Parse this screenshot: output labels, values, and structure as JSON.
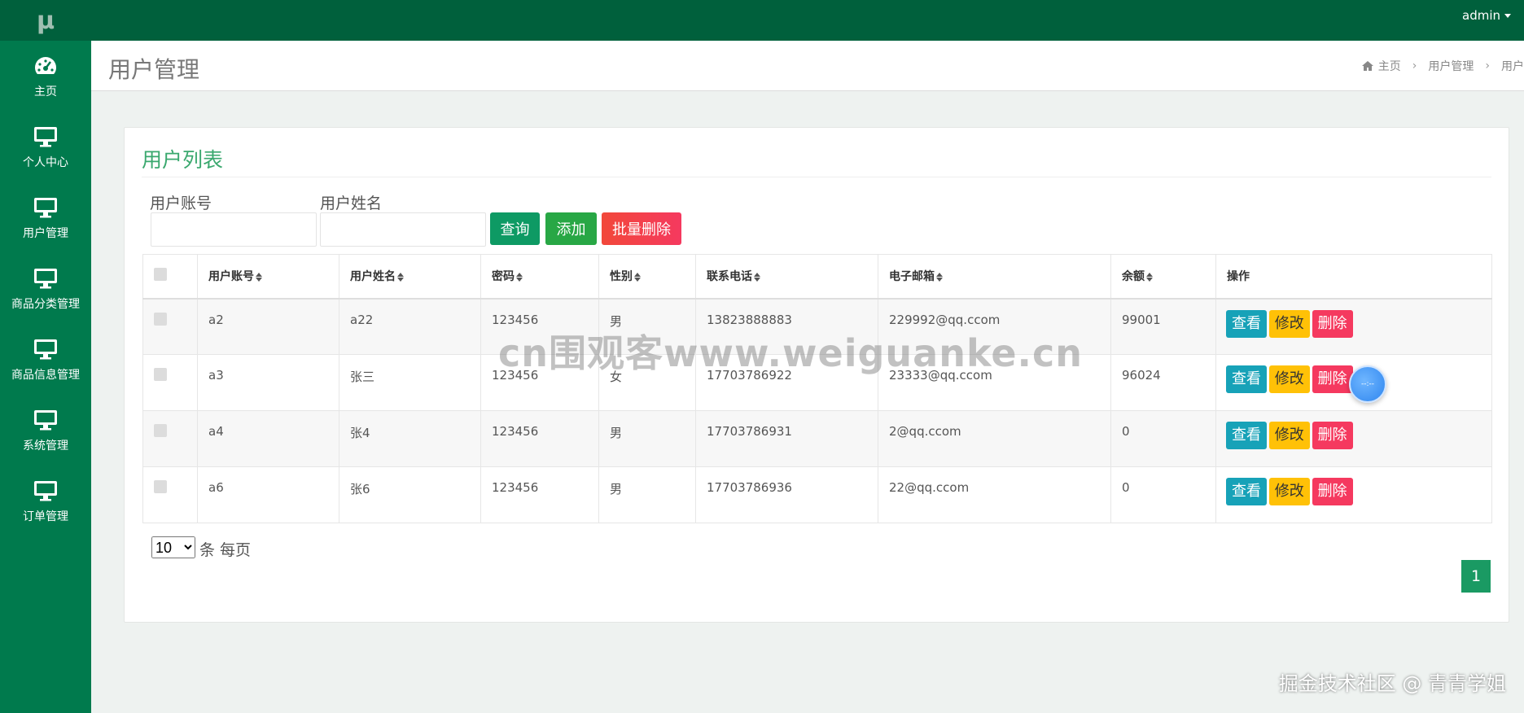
{
  "app": {
    "logo": "μ",
    "user_menu": "admin"
  },
  "sidebar": {
    "items": [
      {
        "label": "主页",
        "icon": "dashboard-icon"
      },
      {
        "label": "个人中心",
        "icon": "monitor-icon"
      },
      {
        "label": "用户管理",
        "icon": "monitor-icon"
      },
      {
        "label": "商品分类管理",
        "icon": "monitor-icon"
      },
      {
        "label": "商品信息管理",
        "icon": "monitor-icon"
      },
      {
        "label": "系统管理",
        "icon": "monitor-icon"
      },
      {
        "label": "订单管理",
        "icon": "monitor-icon"
      }
    ]
  },
  "header": {
    "title": "用户管理",
    "breadcrumb": [
      "主页",
      "用户管理",
      "用户"
    ]
  },
  "panel": {
    "title": "用户列表",
    "search": {
      "account_label": "用户账号",
      "name_label": "用户姓名",
      "account_value": "",
      "name_value": "",
      "query_button": "查询",
      "add_button": "添加",
      "batch_delete_button": "批量删除"
    },
    "table": {
      "columns": [
        "用户账号",
        "用户姓名",
        "密码",
        "性别",
        "联系电话",
        "电子邮箱",
        "余额",
        "操作"
      ],
      "rows": [
        {
          "account": "a2",
          "name": "a22",
          "password": "123456",
          "gender": "男",
          "phone": "13823888883",
          "email": "229992@qq.ccom",
          "balance": "99001"
        },
        {
          "account": "a3",
          "name": "张三",
          "password": "123456",
          "gender": "女",
          "phone": "17703786922",
          "email": "23333@qq.ccom",
          "balance": "96024"
        },
        {
          "account": "a4",
          "name": "张4",
          "password": "123456",
          "gender": "男",
          "phone": "17703786931",
          "email": "2@qq.ccom",
          "balance": "0"
        },
        {
          "account": "a6",
          "name": "张6",
          "password": "123456",
          "gender": "男",
          "phone": "17703786936",
          "email": "22@qq.ccom",
          "balance": "0"
        }
      ],
      "actions": {
        "view": "查看",
        "edit": "修改",
        "delete": "删除"
      }
    },
    "pagination": {
      "page_size": "10",
      "page_size_options": [
        "10"
      ],
      "per_page_label": "条 每页",
      "current_page": "1"
    }
  },
  "overlay": {
    "watermark": "cn围观客www.weiguanke.cn",
    "float_ball": "--:--",
    "credit": "掘金技术社区 @ 青青学姐"
  },
  "colors": {
    "sidebar": "#007a4d",
    "topbar": "#00603c",
    "accent_title": "#3aa86e",
    "query": "#0e9a64",
    "add": "#28a745",
    "batch_delete": "#f5395f",
    "view": "#17a2b8",
    "edit": "#ffc107",
    "delete": "#f5395f"
  }
}
